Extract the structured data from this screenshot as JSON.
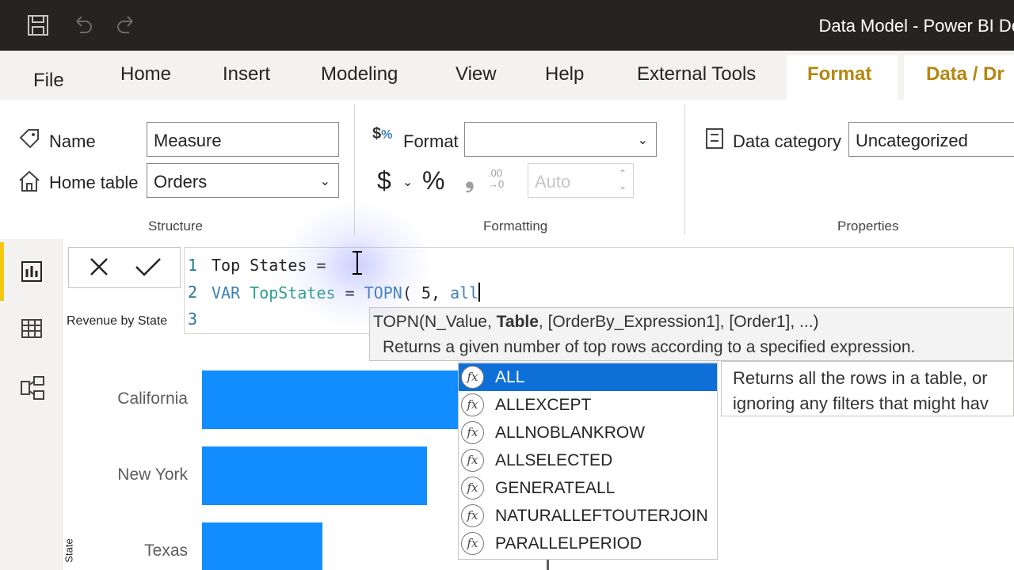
{
  "titlebar": {
    "title": "Data Model - Power BI Des"
  },
  "tabs": [
    "File",
    "Home",
    "Insert",
    "Modeling",
    "View",
    "Help",
    "External Tools",
    "Format",
    "Data / Dr"
  ],
  "structure": {
    "name_label": "Name",
    "name_value": "Measure",
    "home_table_label": "Home table",
    "home_table_value": "Orders",
    "group_label": "Structure"
  },
  "formatting": {
    "format_label": "Format",
    "format_value": "",
    "currency_symbol": "$",
    "percent_symbol": "%",
    "auto_value": "Auto",
    "group_label": "Formatting"
  },
  "properties": {
    "data_category_label": "Data category",
    "data_category_value": "Uncategorized",
    "group_label": "Properties"
  },
  "formula": {
    "line_numbers": [
      "1",
      "2",
      "3"
    ],
    "line1": "Top States =",
    "line2_kw": "VAR",
    "line2_var": "TopStates",
    "line2_eq": " = ",
    "line2_fn": "TOPN",
    "line2_rest": "( 5, ",
    "line2_typed": "all"
  },
  "signature": {
    "prefix": "TOPN(N_Value, ",
    "current_param": "Table",
    "suffix": ", [OrderBy_Expression1], [Order1], ...)",
    "description": "Returns a given number of top rows according to a specified expression."
  },
  "autocomplete": {
    "icon_text": "fx",
    "items": [
      "ALL",
      "ALLEXCEPT",
      "ALLNOBLANKROW",
      "ALLSELECTED",
      "GENERATEALL",
      "NATURALLEFTOUTERJOIN",
      "PARALLELPERIOD"
    ],
    "selected_index": 0,
    "description_line1": "Returns all the rows in a table, or",
    "description_line2": "ignoring any filters that might hav"
  },
  "chart": {
    "title": "Revenue by State",
    "y_axis_title": "State"
  },
  "chart_data": {
    "type": "bar",
    "title": "Revenue by State",
    "categories": [
      "California",
      "New York",
      "Texas"
    ],
    "ylabel": "State",
    "xlabel": "",
    "values_relative": [
      1.0,
      0.788,
      0.422
    ]
  },
  "colors": {
    "bar": "#118dff",
    "accent_tab": "#b48711",
    "selection": "#0e6fd8",
    "rail_indicator": "#f2c811"
  },
  "icons": {
    "save": "save-icon",
    "undo": "undo-icon",
    "redo": "redo-icon",
    "name": "tag-icon",
    "home_table": "home-icon",
    "format": "format-icon",
    "data_category": "data-category-icon",
    "report_view": "report-view-icon",
    "data_view": "data-view-icon",
    "model_view": "model-view-icon"
  }
}
